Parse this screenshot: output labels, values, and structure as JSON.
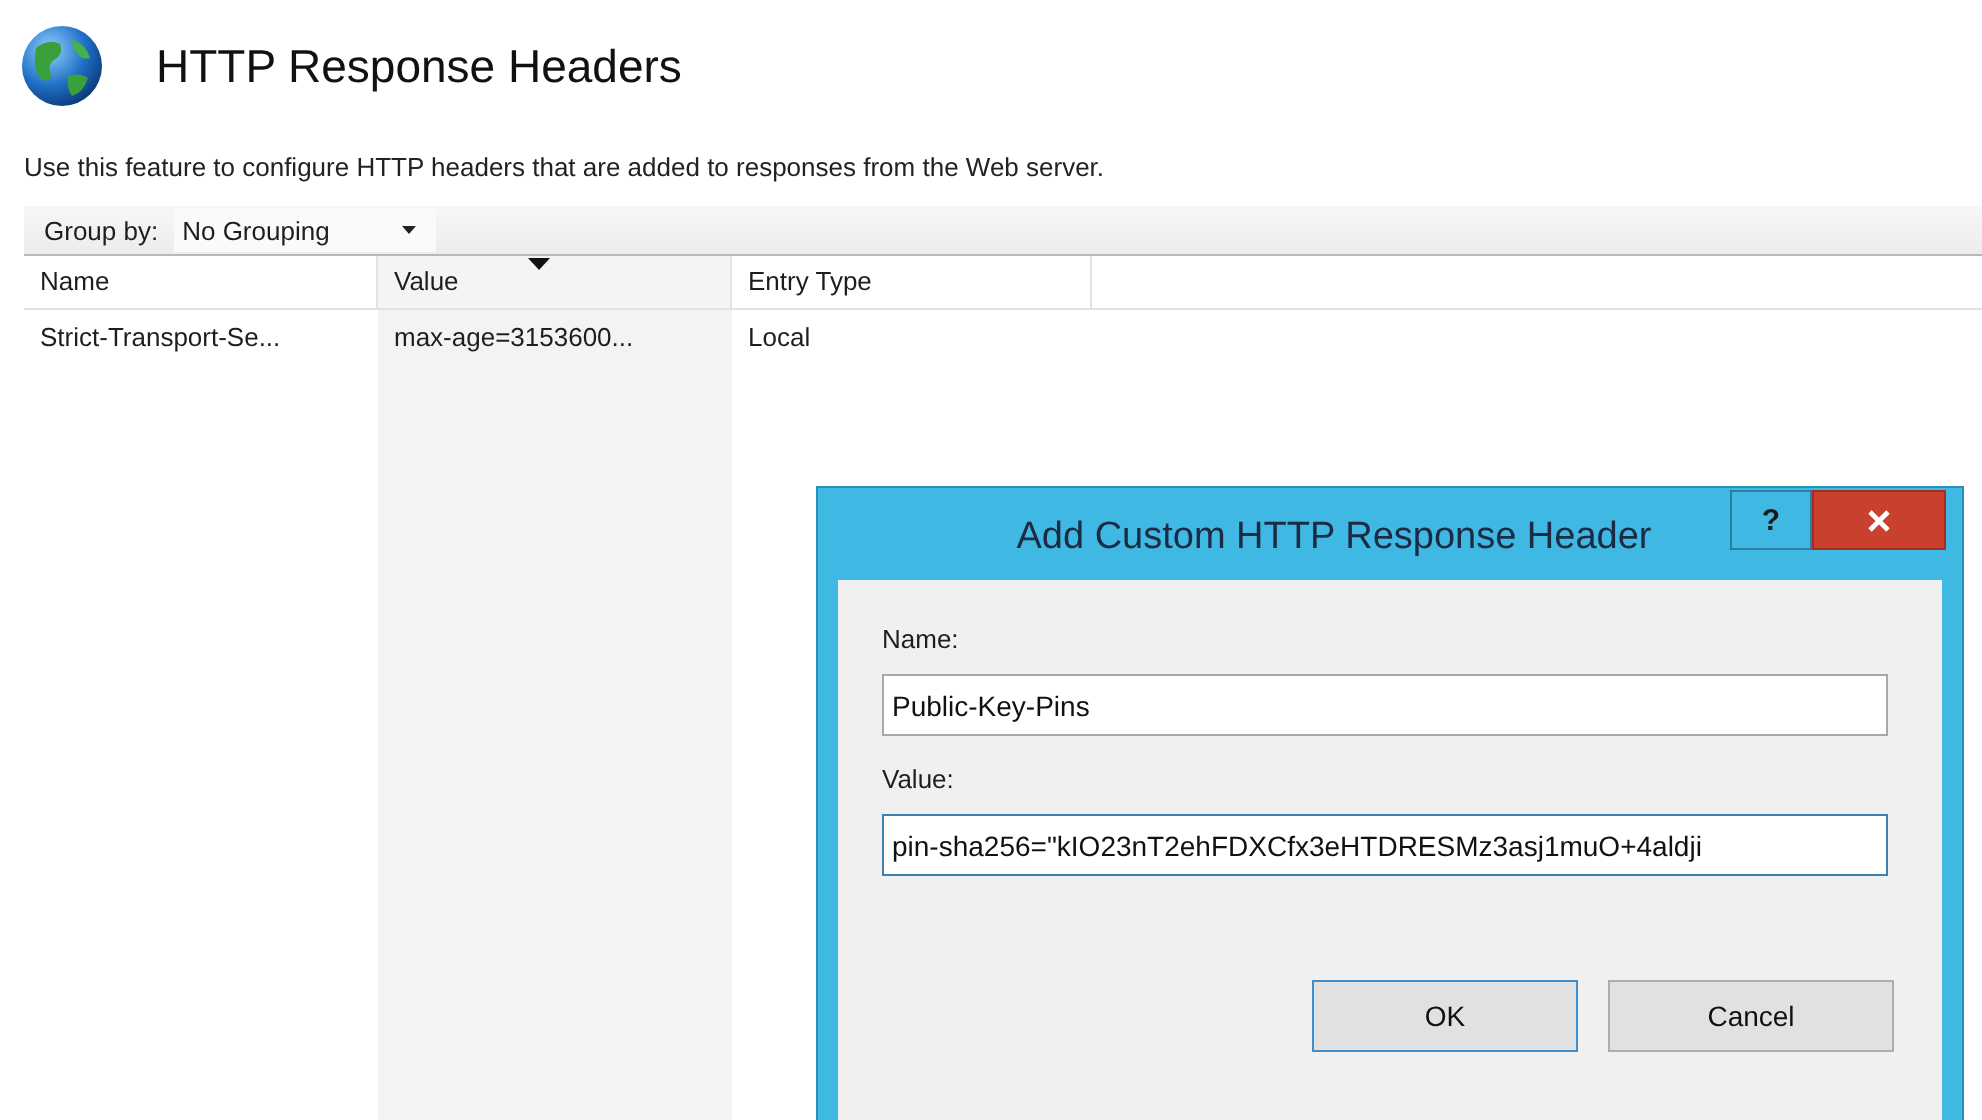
{
  "page": {
    "title": "HTTP Response Headers",
    "description": "Use this feature to configure HTTP headers that are added to responses from the Web server."
  },
  "toolbar": {
    "group_by_label": "Group by:",
    "group_by_value": "No Grouping"
  },
  "table": {
    "columns": [
      {
        "label": "Name",
        "sorted": false
      },
      {
        "label": "Value",
        "sorted": true
      },
      {
        "label": "Entry Type",
        "sorted": false
      }
    ],
    "rows": [
      {
        "cells": [
          "Strict-Transport-Se...",
          "max-age=3153600...",
          "Local"
        ]
      }
    ]
  },
  "dialog": {
    "title": "Add Custom HTTP Response Header",
    "help": "?",
    "fields": [
      {
        "label": "Name:",
        "value": "Public-Key-Pins",
        "focused": false
      },
      {
        "label": "Value:",
        "value": "pin-sha256=\"kIO23nT2ehFDXCfx3eHTDRESMz3asj1muO+4aldji",
        "focused": true
      }
    ],
    "buttons": [
      {
        "label": "OK",
        "default": true
      },
      {
        "label": "Cancel",
        "default": false
      }
    ]
  }
}
